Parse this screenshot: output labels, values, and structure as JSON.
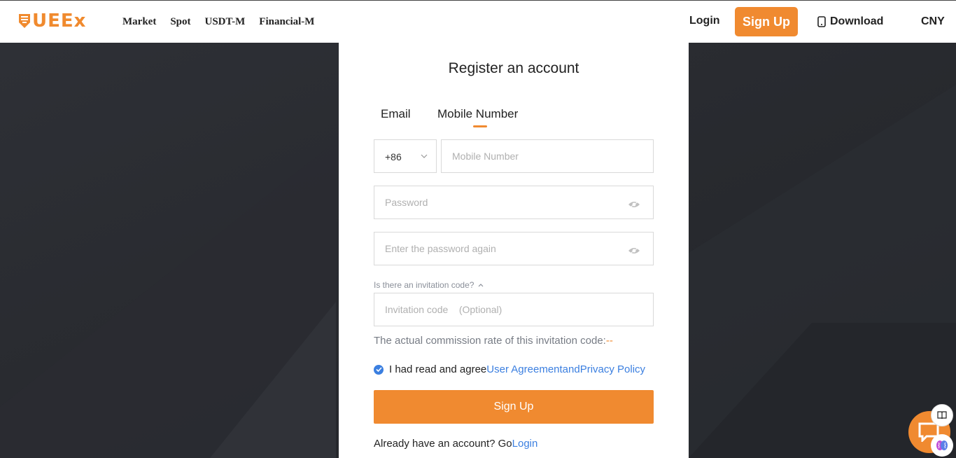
{
  "header": {
    "logo_text": "UEEx",
    "nav": [
      "Market",
      "Spot",
      "USDT-M",
      "Financial-M"
    ],
    "login_label": "Login",
    "signup_label": "Sign Up",
    "download_label": "Download",
    "currency_label": "CNY"
  },
  "form": {
    "title": "Register an account",
    "tabs": [
      {
        "label": "Email",
        "active": false
      },
      {
        "label": "Mobile Number",
        "active": true
      }
    ],
    "country_code": "+86",
    "mobile_placeholder": "Mobile Number",
    "password_placeholder": "Password",
    "password_again_placeholder": "Enter the password again",
    "invite_toggle_label": "Is there an invitation code?",
    "invite_placeholder": "Invitation code    (Optional)",
    "commission_label": "The actual commission rate of this invitation code:",
    "commission_value": "--",
    "agree_text": "I had read and agree",
    "user_agreement_link": "User Agreement",
    "and_text": "and",
    "privacy_link": "Privacy Policy",
    "submit_label": "Sign Up",
    "already_text": "Already have an account? Go",
    "login_link": "Login"
  },
  "colors": {
    "brand": "#f08a30",
    "link": "#3b7fe0",
    "background": "#26282e"
  }
}
